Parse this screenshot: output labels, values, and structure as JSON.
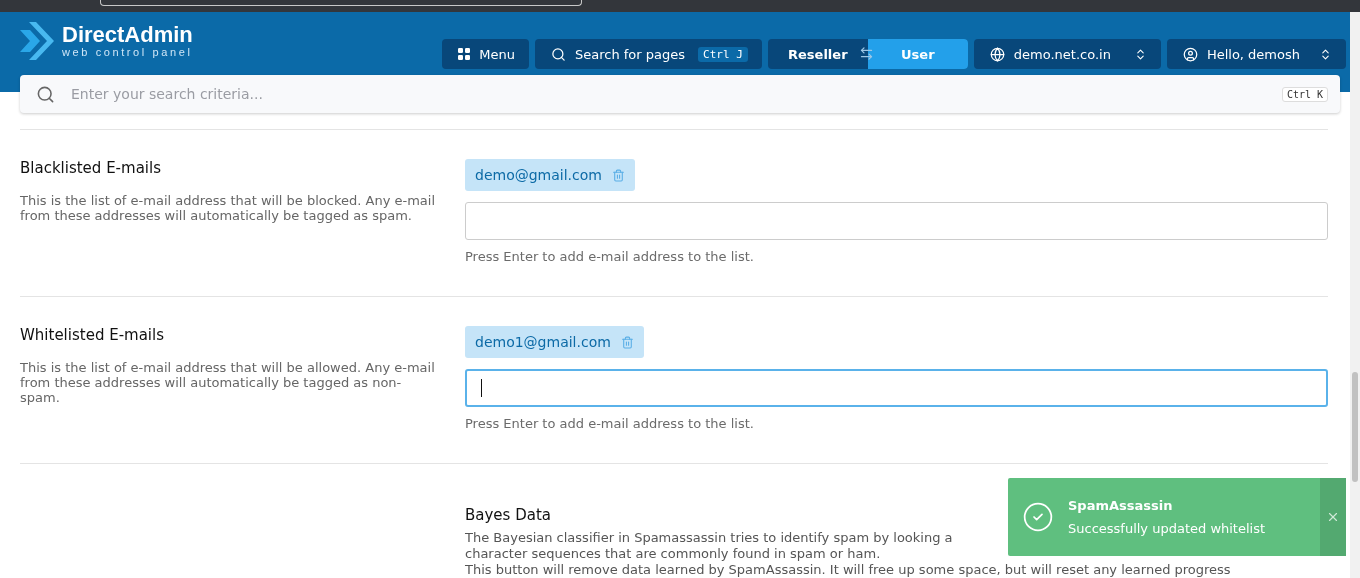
{
  "header": {
    "logo": {
      "name": "DirectAdmin",
      "tagline": "web control panel"
    },
    "menu_button": "Menu",
    "page_search": {
      "label": "Search for pages",
      "shortcut": "Ctrl J"
    },
    "role_switch": [
      {
        "label": "Reseller",
        "selected": false
      },
      {
        "label": "User",
        "selected": true
      }
    ],
    "domain_select": "demo.net.co.in",
    "user_menu": "Hello, demosh"
  },
  "search": {
    "placeholder": "Enter your search criteria...",
    "shortcut": "Ctrl K"
  },
  "sections": [
    {
      "title": "Blacklisted E-mails",
      "description": "This is the list of e-mail address that will be blocked. Any e-mail from these addresses will automatically be tagged as spam.",
      "tags": [
        "demo@gmail.com"
      ],
      "focused": false,
      "hint": "Press Enter to add e-mail address to the list."
    },
    {
      "title": "Whitelisted E-mails",
      "description": "This is the list of e-mail address that will be allowed. Any e-mail from these addresses will automatically be tagged as non-spam.",
      "tags": [
        "demo1@gmail.com"
      ],
      "focused": true,
      "hint": "Press Enter to add e-mail address to the list."
    }
  ],
  "bayes": {
    "title": "Bayes Data",
    "lines": [
      "The Bayesian classifier in Spamassassin tries to identify spam by looking a",
      "character sequences that are commonly found in spam or ham.",
      "This button will remove data learned by SpamAssassin. It will free up some space, but will reset any learned progress"
    ]
  },
  "toast": {
    "title": "SpamAssassin",
    "message": "Successfully updated whitelist"
  }
}
